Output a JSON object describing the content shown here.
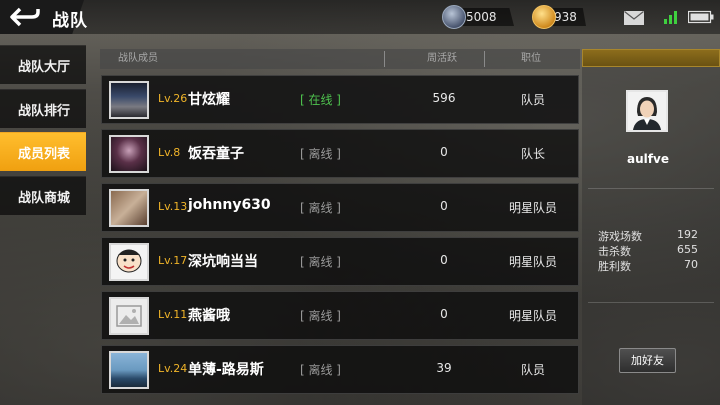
{
  "header": {
    "title": "战队",
    "rank_points": "5008",
    "coins": "938"
  },
  "nav": [
    {
      "label": "战队大厅",
      "active": false
    },
    {
      "label": "战队排行",
      "active": false
    },
    {
      "label": "成员列表",
      "active": true
    },
    {
      "label": "战队商城",
      "active": false
    }
  ],
  "table": {
    "columns": [
      "战队成员",
      "周活跃",
      "职位"
    ],
    "rows": [
      {
        "level": "Lv.26",
        "name": "甘炫耀",
        "status": "[ 在线 ]",
        "online": true,
        "activity": "596",
        "role": "队员"
      },
      {
        "level": "Lv.8",
        "name": "饭吞童子",
        "status": "[ 离线 ]",
        "online": false,
        "activity": "0",
        "role": "队长"
      },
      {
        "level": "Lv.13",
        "name": "johnny630",
        "status": "[ 离线 ]",
        "online": false,
        "activity": "0",
        "role": "明星队员"
      },
      {
        "level": "Lv.17",
        "name": "深坑响当当",
        "status": "[ 离线 ]",
        "online": false,
        "activity": "0",
        "role": "明星队员"
      },
      {
        "level": "Lv.11",
        "name": "燕酱哦",
        "status": "[ 离线 ]",
        "online": false,
        "activity": "0",
        "role": "明星队员"
      },
      {
        "level": "Lv.24",
        "name": "单薄-路易斯",
        "status": "[ 离线 ]",
        "online": false,
        "activity": "39",
        "role": "队员"
      }
    ]
  },
  "profile": {
    "name": "aulfve",
    "stats": [
      {
        "label": "游戏场数",
        "value": "192"
      },
      {
        "label": "击杀数",
        "value": "655"
      },
      {
        "label": "胜利数",
        "value": "70"
      }
    ],
    "add_friend_label": "加好友"
  },
  "colors": {
    "accent": "#f0a010",
    "level": "#f0b429",
    "online": "#4ec24e",
    "offline": "#9a9a9a"
  },
  "icons": [
    "back-arrow-icon",
    "rank-badge-icon",
    "coin-icon",
    "mail-icon",
    "signal-icon",
    "battery-icon"
  ]
}
